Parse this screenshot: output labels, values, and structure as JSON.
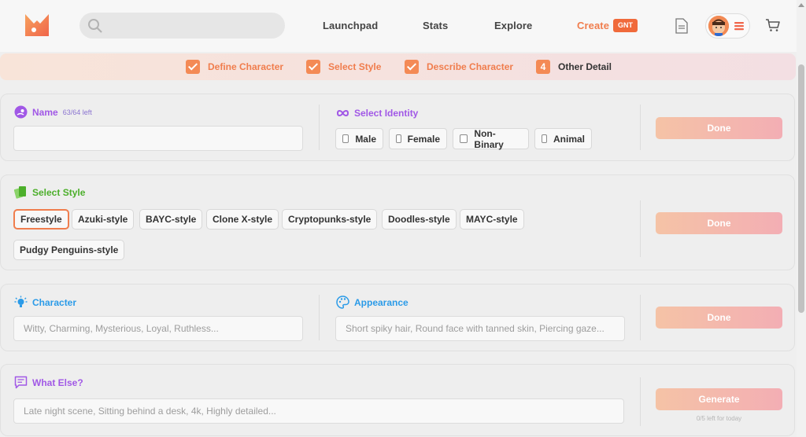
{
  "header": {
    "nav": [
      "Launchpad",
      "Stats",
      "Explore",
      "Create"
    ],
    "create_badge": "GNT",
    "search_placeholder": "",
    "accent": "#f07d4d"
  },
  "steps": [
    {
      "label": "Define Character",
      "state": "done"
    },
    {
      "label": "Select Style",
      "state": "done"
    },
    {
      "label": "Describe Character",
      "state": "done"
    },
    {
      "number": "4",
      "label": "Other Detail",
      "state": "current"
    }
  ],
  "name_section": {
    "label": "Name",
    "hint": "63/64 left",
    "value": ""
  },
  "identity_section": {
    "label": "Select Identity",
    "options": [
      "Male",
      "Female",
      "Non-Binary",
      "Animal"
    ]
  },
  "style_section": {
    "label": "Select Style",
    "chips": [
      "Freestyle",
      "Azuki-style",
      "BAYC-style",
      "Clone X-style",
      "Cryptopunks-style",
      "Doodles-style",
      "MAYC-style",
      "Pudgy Penguins-style"
    ],
    "selected": "Freestyle"
  },
  "character_section": {
    "label": "Character",
    "placeholder": "Witty, Charming, Mysterious, Loyal, Ruthless..."
  },
  "appearance_section": {
    "label": "Appearance",
    "placeholder": "Short spiky hair, Round face with tanned skin, Piercing gaze..."
  },
  "whatelse_section": {
    "label": "What Else?",
    "placeholder": "Late night scene, Sitting behind a desk, 4k, Highly detailed..."
  },
  "buttons": {
    "done": "Done",
    "generate": "Generate",
    "generate_note": "0/5 left for today"
  }
}
